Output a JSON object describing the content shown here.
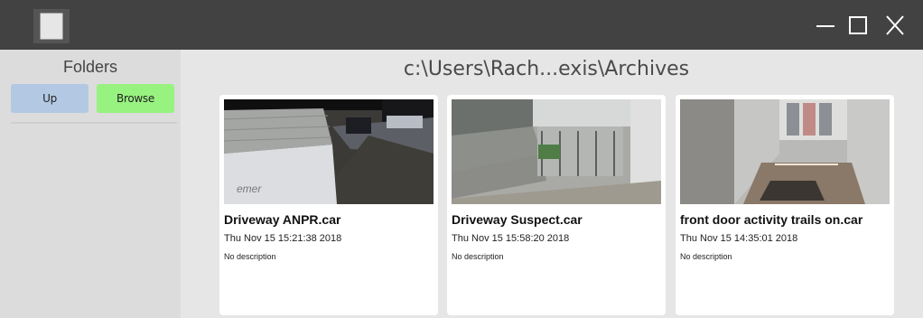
{
  "window": {
    "app_icon": "folder-icon",
    "controls": [
      "minimize-icon",
      "maximize-icon",
      "close-icon"
    ]
  },
  "sidebar": {
    "title": "Folders",
    "up_label": "Up",
    "browse_label": "Browse",
    "up_color": "#b3c9e3",
    "browse_color": "#98f280"
  },
  "main": {
    "path": "c:\\Users\\Rach...exis\\Archives",
    "files": [
      {
        "name": "Driveway ANPR.car",
        "date": "Thu Nov 15 15:21:38 2018",
        "description": "No description",
        "thumbnail": "driveway-night-camera-image"
      },
      {
        "name": "Driveway Suspect.car",
        "date": "Thu Nov 15 15:58:20 2018",
        "description": "No description",
        "thumbnail": "driveway-gate-camera-image"
      },
      {
        "name": "front door activity trails on.car",
        "date": "Thu Nov 15 14:35:01 2018",
        "description": "No description",
        "thumbnail": "front-door-camera-image"
      }
    ]
  }
}
